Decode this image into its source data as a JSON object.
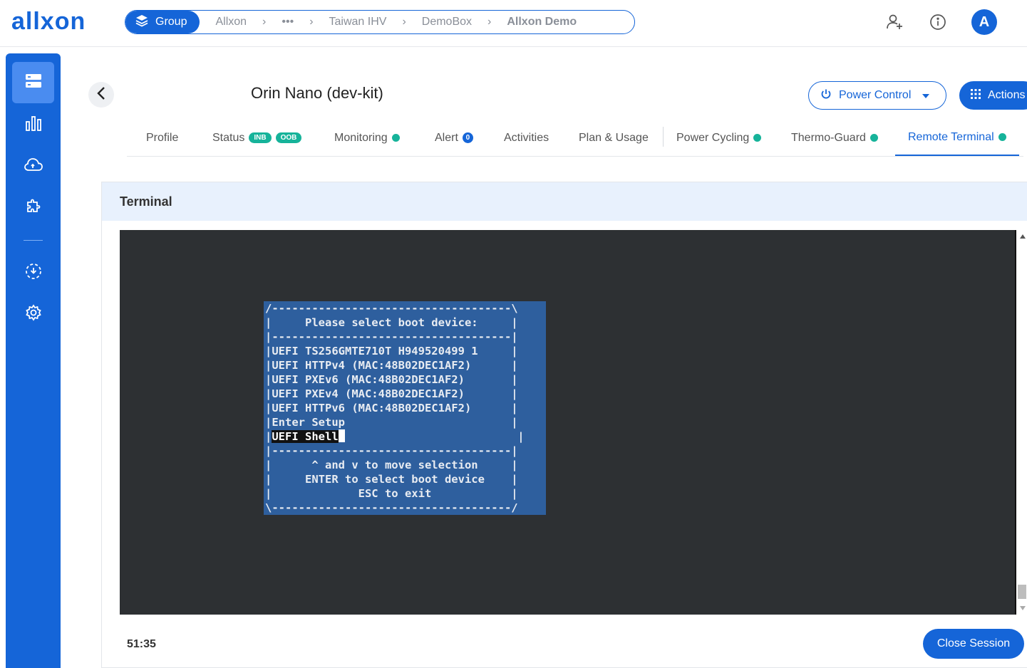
{
  "brand": {
    "logo_text": "allxon",
    "accent": "#1565d8",
    "success": "#16b39a"
  },
  "breadcrumb": {
    "group_label": "Group",
    "items": [
      "Allxon",
      "•••",
      "Taiwan IHV",
      "DemoBox"
    ],
    "current": "Allxon Demo"
  },
  "topbar": {
    "avatar_letter": "A",
    "icons": [
      "add-user-icon",
      "info-icon"
    ]
  },
  "sidebar": {
    "icons": [
      "devices-icon",
      "chart-icon",
      "cloud-sync-icon",
      "plugin-icon",
      "ota-icon",
      "settings-icon"
    ],
    "active_index": 0
  },
  "device": {
    "title": "Orin Nano (dev-kit)"
  },
  "header": {
    "power_label": "Power Control",
    "actions_label": "Actions"
  },
  "tabs": {
    "profile": "Profile",
    "status": "Status",
    "status_badges": [
      "INB",
      "OOB"
    ],
    "monitoring": "Monitoring",
    "alert": "Alert",
    "alert_count": "0",
    "activities": "Activities",
    "plan": "Plan & Usage",
    "power_cycling": "Power Cycling",
    "thermo": "Thermo-Guard",
    "remote": "Remote Terminal"
  },
  "terminal": {
    "title": "Terminal",
    "lines": [
      "/------------------------------------\\",
      "|     Please select boot device:     |",
      "|------------------------------------|",
      "|UEFI TS256GMTE710T H949520499 1     |",
      "|UEFI HTTPv4 (MAC:48B02DEC1AF2)      |",
      "|UEFI PXEv6 (MAC:48B02DEC1AF2)       |",
      "|UEFI PXEv4 (MAC:48B02DEC1AF2)       |",
      "|UEFI HTTPv6 (MAC:48B02DEC1AF2)      |",
      "|Enter Setup                         |"
    ],
    "selected_prefix": "|",
    "selected_item": "UEFI Shell",
    "selected_suffix": "                          |",
    "footer_lines": [
      "|------------------------------------|",
      "|      ^ and v to move selection     |",
      "|     ENTER to select boot device    |",
      "|             ESC to exit            |",
      "\\------------------------------------/"
    ]
  },
  "session": {
    "timer": "51:35",
    "close_label": "Close Session"
  }
}
